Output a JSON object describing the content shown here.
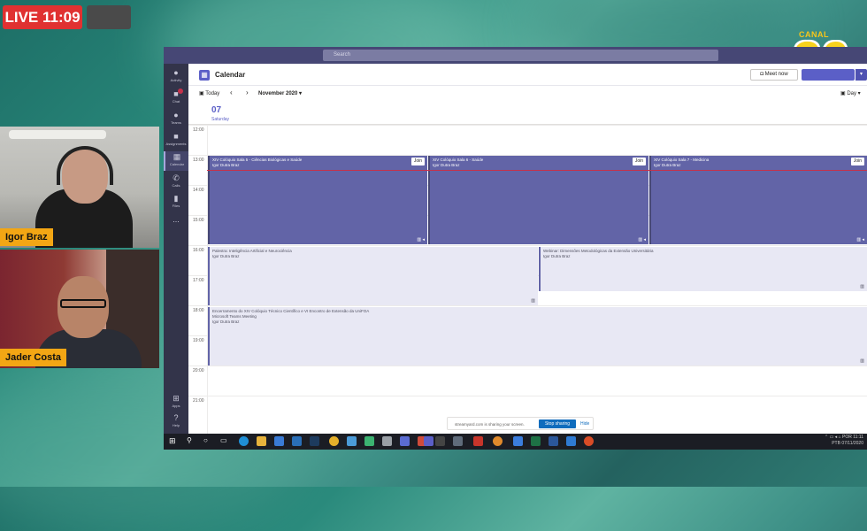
{
  "overlay": {
    "live_label": "LIVE 11:09",
    "logo_canal": "CANAL",
    "logo_number": "36",
    "participants": [
      {
        "name": "Igor Braz"
      },
      {
        "name": "Jader Costa"
      }
    ]
  },
  "teams": {
    "search_placeholder": "Search",
    "rail": [
      {
        "icon": "bell-icon",
        "label": "Activity",
        "badge": false
      },
      {
        "icon": "chat-icon",
        "label": "Chat",
        "badge": true
      },
      {
        "icon": "teams-icon",
        "label": "Teams",
        "badge": false
      },
      {
        "icon": "assignments-icon",
        "label": "Assignments",
        "badge": false
      },
      {
        "icon": "calendar-icon",
        "label": "Calendar",
        "badge": false,
        "active": true
      },
      {
        "icon": "calls-icon",
        "label": "Calls",
        "badge": false
      },
      {
        "icon": "files-icon",
        "label": "Files",
        "badge": false
      }
    ],
    "rail_more": "...",
    "rail_bottom": [
      {
        "icon": "apps-icon",
        "label": "Apps"
      },
      {
        "icon": "help-icon",
        "label": "Help"
      }
    ],
    "header": {
      "title": "Calendar",
      "meet_now": "Meet now",
      "view": "Day"
    },
    "nav": {
      "today": "Today",
      "month": "November 2020"
    },
    "day": {
      "number": "07",
      "name": "Saturday"
    },
    "hours": [
      "12:00",
      "13:00",
      "14:00",
      "15:00",
      "16:00",
      "17:00",
      "18:00",
      "19:00",
      "20:00",
      "21:00"
    ],
    "events": [
      {
        "title": "XIV Colóquio Sala 5 - Ciências Biológicas e Saúde",
        "organizer": "Igor Dutra Braz",
        "join": "Join",
        "style": "dark"
      },
      {
        "title": "XIV Colóquio Sala 6 - Saúde",
        "organizer": "Igor Dutra Braz",
        "join": "Join",
        "style": "dark"
      },
      {
        "title": "XIV Colóquio Sala 7 - Medicina",
        "organizer": "Igor Dutra Braz",
        "join": "Join",
        "style": "dark"
      },
      {
        "title": "Palestra: Inteligência Artificial e Neurociência",
        "organizer": "Igor Dutra Braz",
        "style": "light"
      },
      {
        "title": "Webinar: Dimensões Metodológicas da Extensão Universitária",
        "organizer": "Igor Dutra Braz",
        "style": "light"
      },
      {
        "title": "Encerramento do XIV Colóquio Técnico Científico e VI Encontro de Extensão da UniFOA",
        "location": "Microsoft Teams Meeting",
        "organizer": "Igor Dutra Braz",
        "style": "light"
      }
    ],
    "sharing": {
      "text": "streamyard.com is sharing your screen.",
      "stop": "Stop sharing",
      "hide": "Hide"
    },
    "taskbar": {
      "lang": "POR",
      "layout": "PTB",
      "time": "11:11",
      "date": "07/11/2020"
    }
  }
}
